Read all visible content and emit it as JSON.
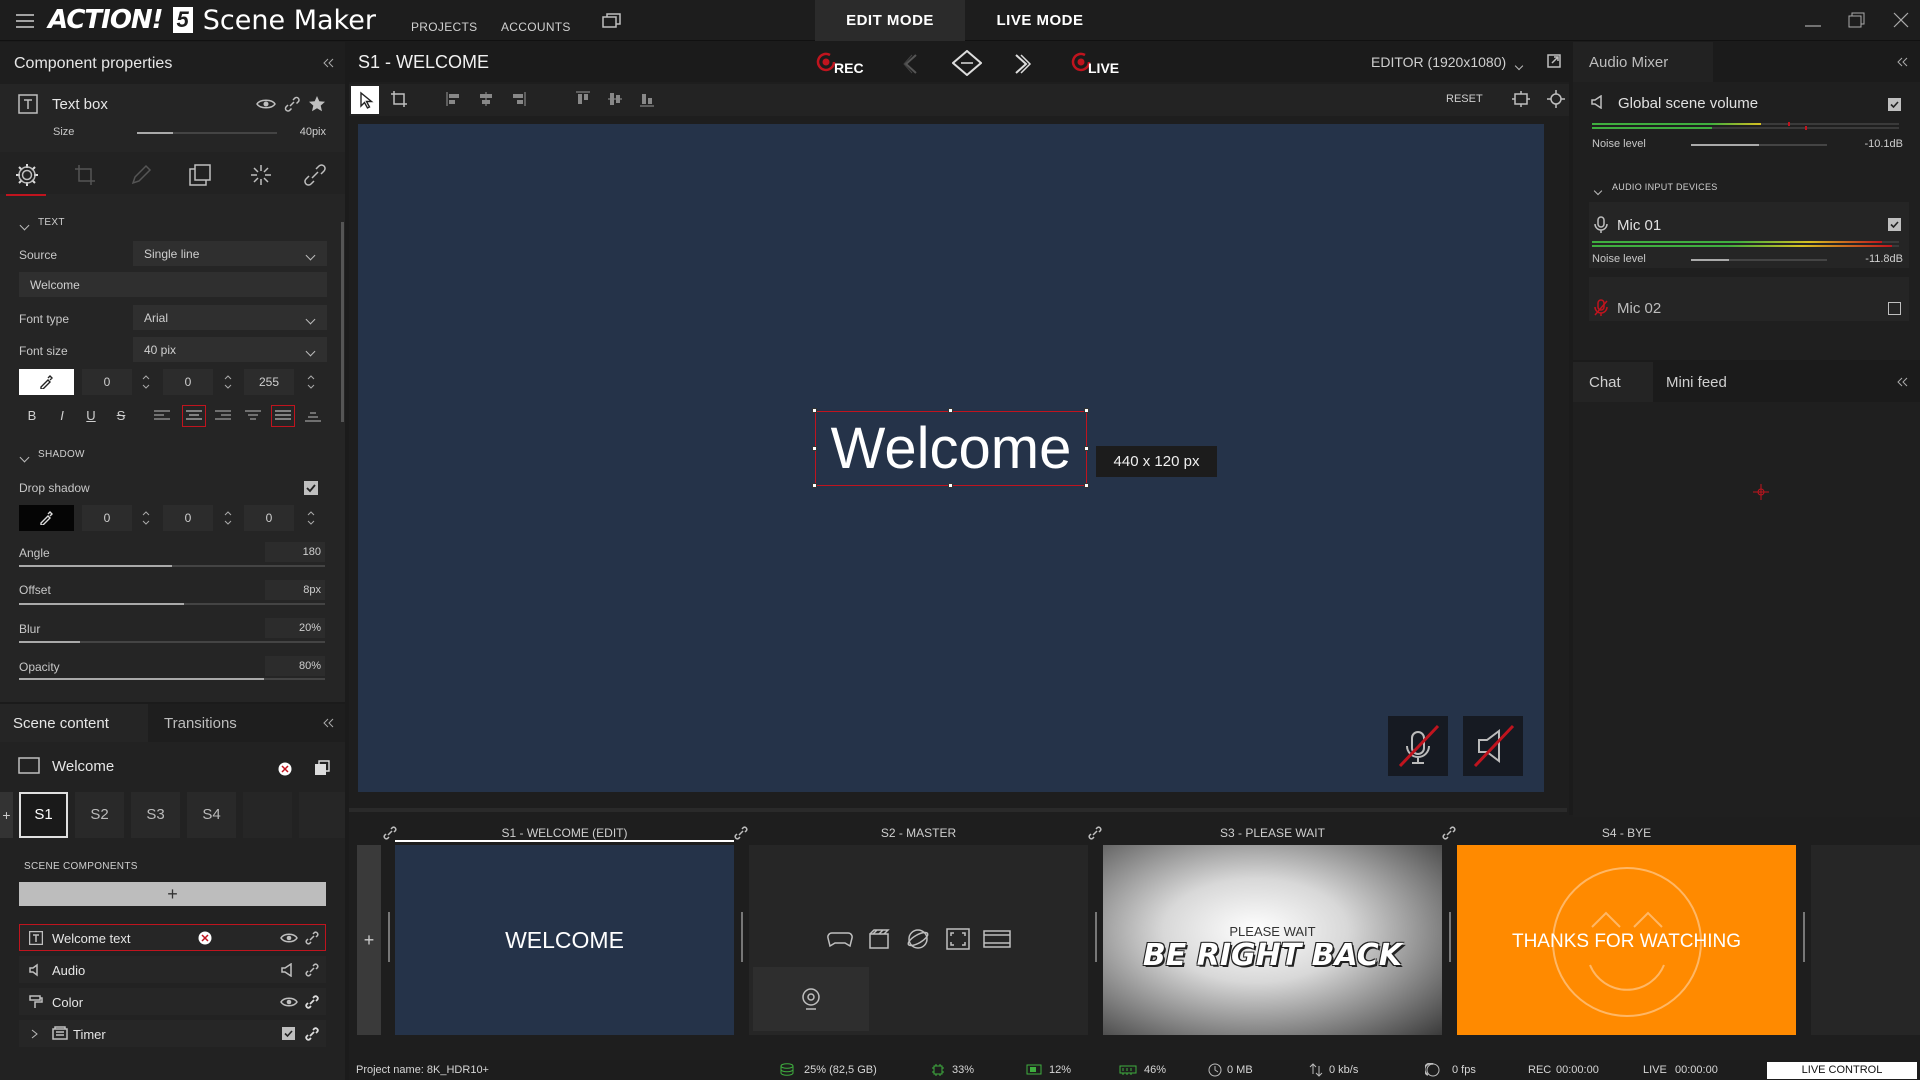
{
  "app": {
    "logo_text": "ACTION!",
    "logo_version": "5",
    "title": "Scene Maker",
    "nav": [
      "PROJECTS",
      "ACCOUNTS"
    ],
    "modes": [
      "EDIT MODE",
      "LIVE MODE"
    ]
  },
  "left_panel": {
    "title": "Component properties",
    "component": {
      "name": "Text box",
      "size_label": "Size",
      "size_value": "40pix",
      "size_fraction": 0.26
    },
    "text_section": {
      "title": "TEXT",
      "source_label": "Source",
      "source_value": "Single line",
      "text_value": "Welcome",
      "font_type_label": "Font type",
      "font_type_value": "Arial",
      "font_size_label": "Font size",
      "font_size_value": "40 pix",
      "color": [
        "0",
        "0",
        "255"
      ],
      "format_buttons": [
        "B",
        "I",
        "U",
        "S"
      ]
    },
    "shadow_section": {
      "title": "SHADOW",
      "drop_shadow_label": "Drop shadow",
      "color": [
        "0",
        "0",
        "0"
      ],
      "angle": {
        "label": "Angle",
        "value": "180",
        "fraction": 0.5
      },
      "offset": {
        "label": "Offset",
        "value": "8px",
        "fraction": 0.54
      },
      "blur": {
        "label": "Blur",
        "value": "20%",
        "fraction": 0.2
      },
      "opacity": {
        "label": "Opacity",
        "value": "80%",
        "fraction": 0.8
      }
    }
  },
  "scene_panel": {
    "tabs": [
      "Scene content",
      "Transitions"
    ],
    "scene_name": "Welcome",
    "scene_buttons": [
      "S1",
      "S2",
      "S3",
      "S4"
    ],
    "components_title": "SCENE COMPONENTS",
    "components": [
      {
        "name": "Welcome text"
      },
      {
        "name": "Audio"
      },
      {
        "name": "Color"
      },
      {
        "name": "Timer"
      }
    ]
  },
  "editor": {
    "scene_title": "S1 - WELCOME",
    "rec_label": "REC",
    "live_label": "LIVE",
    "editor_mode": "EDITOR (1920x1080)",
    "reset_label": "RESET",
    "canvas_text": "Welcome",
    "size_tooltip": "440 x 120 px"
  },
  "scenes_strip": [
    {
      "label": "S1 - WELCOME (EDIT)",
      "text": "WELCOME"
    },
    {
      "label": "S2 - MASTER"
    },
    {
      "label": "S3 - PLEASE WAIT",
      "sub": "PLEASE WAIT",
      "text": "BE RIGHT BACK"
    },
    {
      "label": "S4 - BYE",
      "text": "THANKS FOR WATCHING"
    }
  ],
  "audio_mixer": {
    "title": "Audio Mixer",
    "global_label": "Global scene volume",
    "noise_label": "Noise level",
    "global_db": "-10.1dB",
    "global_level": 0.55,
    "devices_title": "AUDIO INPUT DEVICES",
    "mic1": {
      "name": "Mic 01",
      "db": "-11.8dB",
      "level": 0.28
    },
    "mic2": {
      "name": "Mic 02"
    }
  },
  "chat": {
    "tabs": [
      "Chat",
      "Mini feed"
    ]
  },
  "status": {
    "project": "Project name: 8K_HDR10+",
    "disk": "25% (82,5 GB)",
    "cpu": "33%",
    "gpu": "12%",
    "ram": "46%",
    "mem": "0 MB",
    "net": "0 kb/s",
    "fps": "0 fps",
    "rec_label": "REC",
    "rec_time": "00:00:00",
    "live_label": "LIVE",
    "live_time": "00:00:00",
    "live_control": "LIVE CONTROL"
  },
  "colors": {
    "accent": "#c0141e",
    "canvas": "#253349",
    "orange": "#ff8a00"
  }
}
